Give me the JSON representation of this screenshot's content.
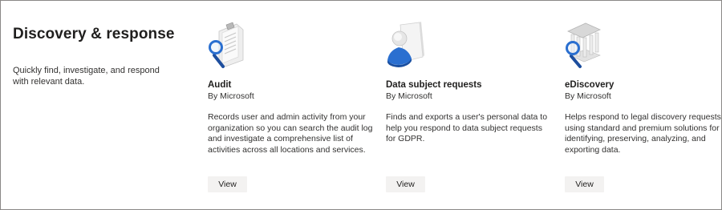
{
  "section": {
    "title": "Discovery & response",
    "description": "Quickly find, investigate, and respond with relevant data."
  },
  "cards": [
    {
      "icon": "audit-magnifier-document-icon",
      "title": "Audit",
      "publisher": "By Microsoft",
      "description": "Records user and admin activity from your organization so you can search the audit log and investigate a comprehensive list of activities across all locations and services.",
      "button": "View"
    },
    {
      "icon": "data-subject-person-document-icon",
      "title": "Data subject requests",
      "publisher": "By Microsoft",
      "description": "Finds and exports a user's personal data to help you respond to data subject requests for GDPR.",
      "button": "View"
    },
    {
      "icon": "ediscovery-courthouse-magnifier-icon",
      "title": "eDiscovery",
      "publisher": "By Microsoft",
      "description": "Helps respond to legal discovery requests using standard and premium solutions for identifying, preserving, analyzing, and exporting data.",
      "button": "View"
    }
  ],
  "colors": {
    "accent_blue": "#2a6fd0",
    "button_bg": "#f3f2f1",
    "border": "#8a8886"
  }
}
